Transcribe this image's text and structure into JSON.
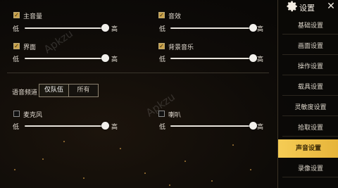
{
  "volume_settings": {
    "master": {
      "label": "主音量",
      "checked": true,
      "low": "低",
      "high": "高",
      "level": 0.98
    },
    "effects": {
      "label": "音效",
      "checked": true,
      "low": "低",
      "high": "高",
      "level": 1.0
    },
    "ui": {
      "label": "界面",
      "checked": true,
      "low": "低",
      "high": "高",
      "level": 0.98
    },
    "music": {
      "label": "背景音乐",
      "checked": true,
      "low": "低",
      "high": "高",
      "level": 1.0
    },
    "mic": {
      "label": "麦克风",
      "checked": false,
      "low": "低",
      "high": "高",
      "level": 0.98
    },
    "speaker": {
      "label": "喇叭",
      "checked": false,
      "low": "低",
      "high": "高",
      "level": 1.0
    }
  },
  "voice_channel": {
    "label": "语音频道",
    "options": [
      "仅队伍",
      "所有"
    ],
    "selected": "仅队伍"
  },
  "sidebar": {
    "title": "设置",
    "close_icon": "close-icon",
    "gear_icon": "gear-icon",
    "items": [
      {
        "label": "基础设置"
      },
      {
        "label": "画面设置"
      },
      {
        "label": "操作设置"
      },
      {
        "label": "载具设置"
      },
      {
        "label": "灵敏度设置"
      },
      {
        "label": "拾取设置"
      },
      {
        "label": "声音设置",
        "active": true
      },
      {
        "label": "录像设置"
      }
    ]
  },
  "watermark": {
    "text": "Apkzu"
  },
  "colors": {
    "accent": "#f5cc55",
    "track": "#e7e3dc",
    "panel_bg": "#0e0b08"
  }
}
